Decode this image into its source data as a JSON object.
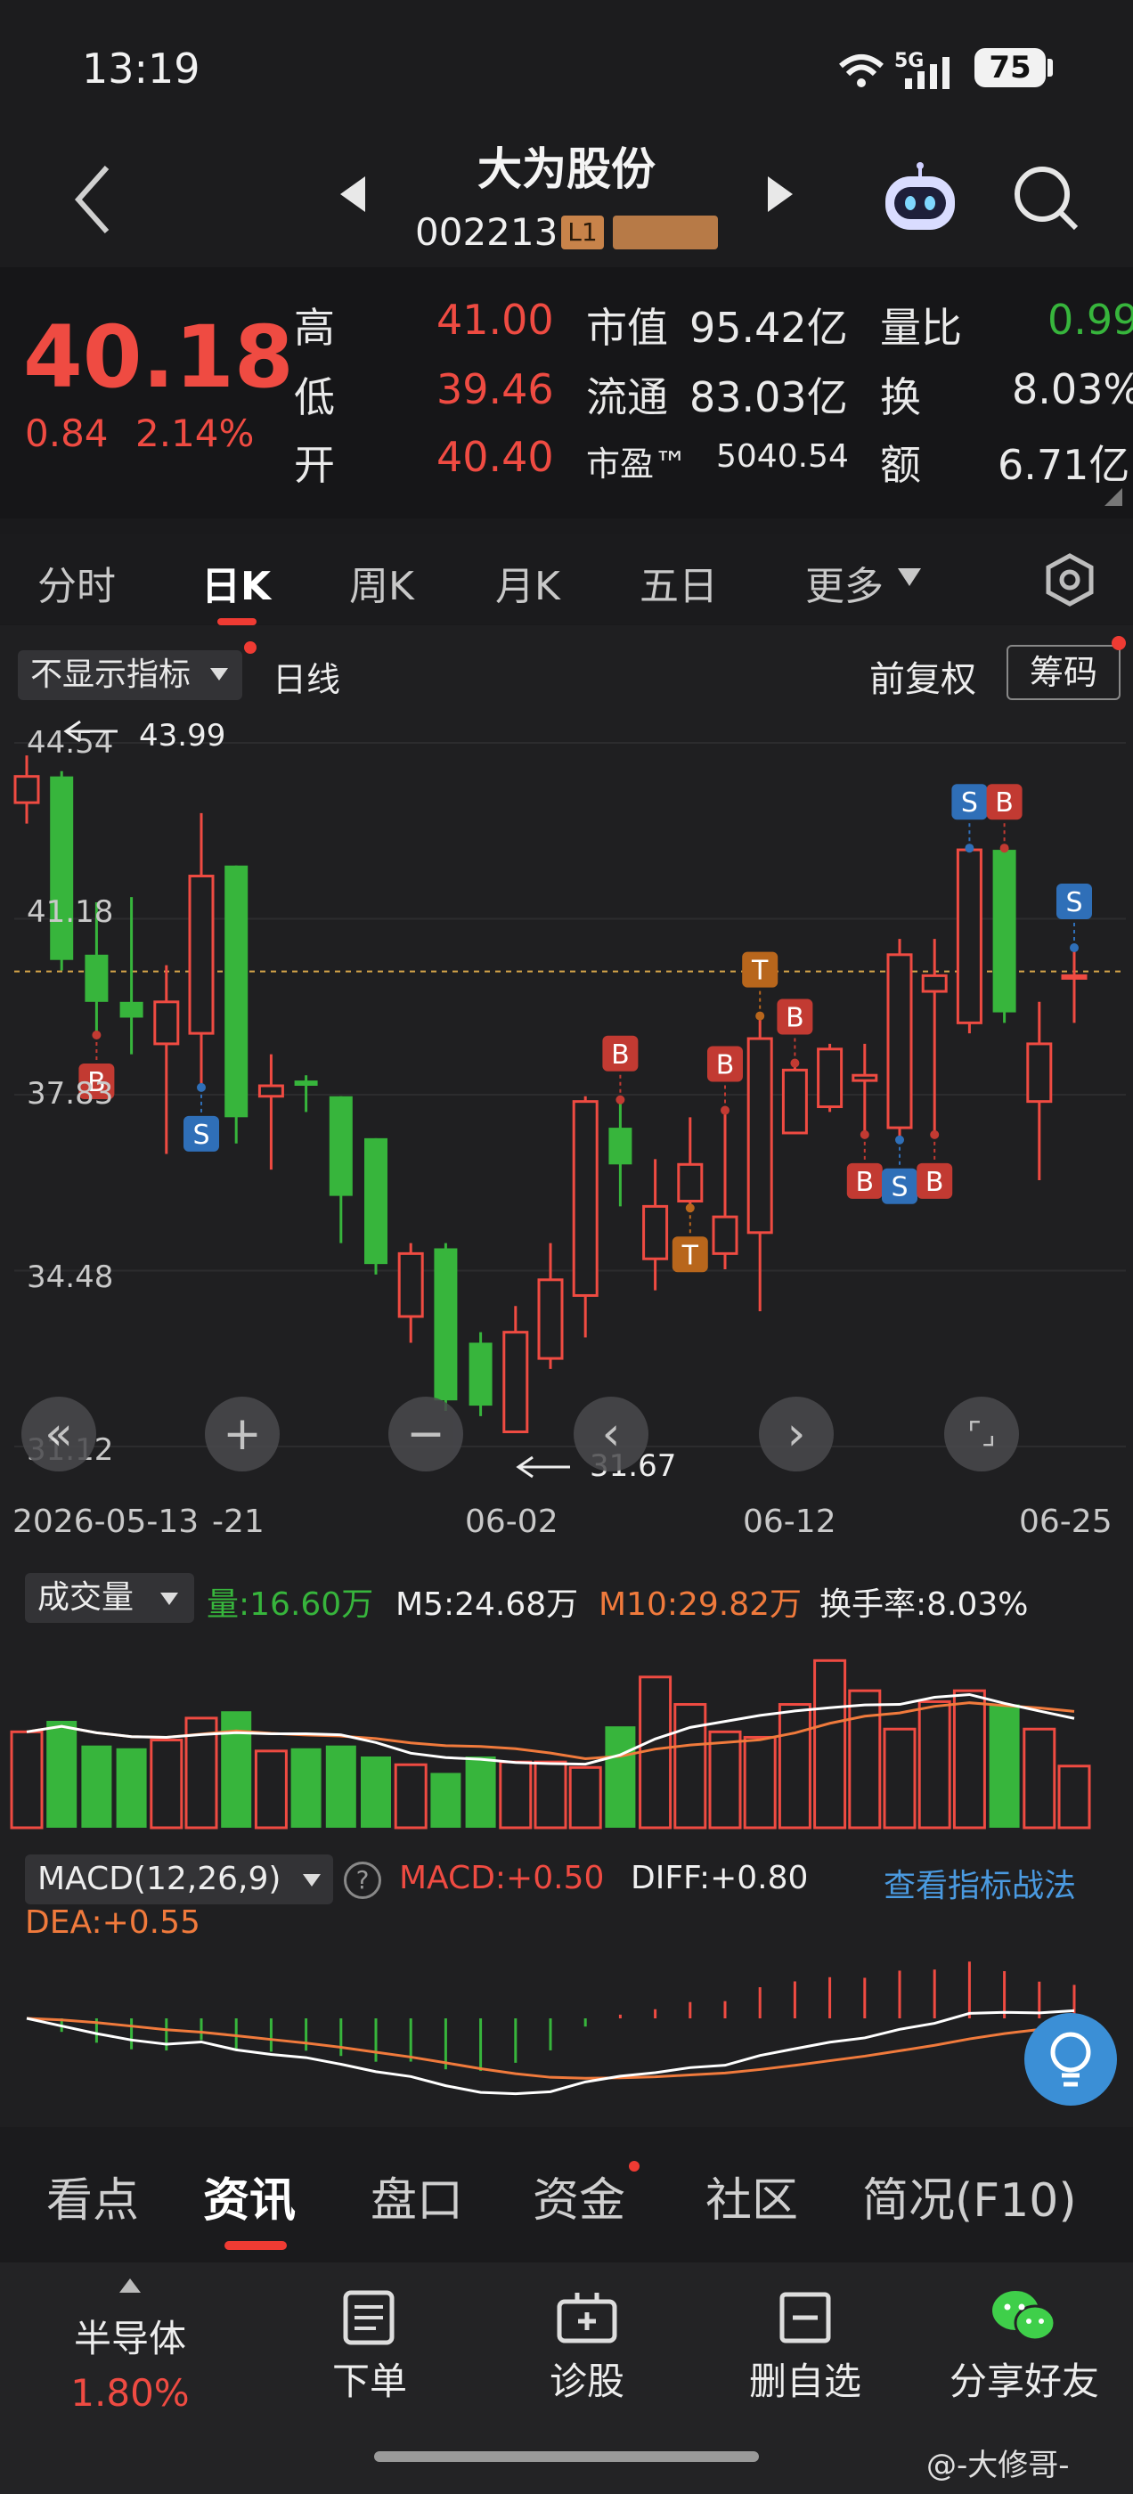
{
  "status_bar": {
    "time": "13:19",
    "network": "5G",
    "battery": "75"
  },
  "header": {
    "stock_name": "大为股份",
    "stock_code": "002213",
    "level_badge": "L1"
  },
  "quote": {
    "price": "40.18",
    "change": "0.84",
    "change_pct": "2.14%",
    "high_label": "高",
    "high": "41.00",
    "low_label": "低",
    "low": "39.46",
    "open_label": "开",
    "open": "40.40",
    "mcap_label": "市值",
    "mcap": "95.42亿",
    "float_label": "流通",
    "float": "83.03亿",
    "pe_label": "市盈™",
    "pe": "5040.54",
    "vol_ratio_label": "量比",
    "vol_ratio": "0.99",
    "turnover_label": "换",
    "turnover": "8.03%",
    "amount_label": "额",
    "amount": "6.71亿"
  },
  "tabs": [
    {
      "label": "分时"
    },
    {
      "label": "日K"
    },
    {
      "label": "周K"
    },
    {
      "label": "月K"
    },
    {
      "label": "五日"
    },
    {
      "label": "更多"
    }
  ],
  "chart_toolbar": {
    "indicator": "不显示指标",
    "period": "日线",
    "adjust": "前复权",
    "chip": "筹码"
  },
  "price_axis": [
    "44.54",
    "41.18",
    "37.83",
    "34.48",
    "31.12"
  ],
  "annotations": {
    "max": "43.99",
    "min": "31.67"
  },
  "date_axis": [
    "2026-05-13",
    "-21",
    "06-02",
    "06-12",
    "06-25"
  ],
  "controls": [
    "«",
    "+",
    "−",
    "‹",
    "›",
    "⌜⌟"
  ],
  "volume": {
    "dropdown": "成交量",
    "vol": "量:16.60万",
    "m5": "M5:24.68万",
    "m10": "M10:29.82万",
    "turnover": "换手率:8.03%"
  },
  "macd": {
    "dropdown": "MACD(12,26,9)",
    "macd": "MACD:+0.50",
    "diff": "DIFF:+0.80",
    "dea": "DEA:+0.55",
    "strategy_link": "查看指标战法"
  },
  "colors": {
    "up": "#ef4b42",
    "down": "#37b53c",
    "buy_marker": "#c23a32",
    "sell_marker": "#2f6fb8",
    "t_marker": "#b8661c"
  },
  "chart_data": {
    "type": "candlestick",
    "candles": [
      {
        "o": 43.4,
        "c": 43.9,
        "h": 44.3,
        "l": 43.0
      },
      {
        "o": 43.9,
        "c": 40.4,
        "h": 44.0,
        "l": 40.2
      },
      {
        "o": 40.5,
        "c": 39.6,
        "h": 41.5,
        "l": 38.9
      },
      {
        "o": 39.6,
        "c": 39.3,
        "h": 41.6,
        "l": 38.6
      },
      {
        "o": 38.8,
        "c": 39.6,
        "h": 40.3,
        "l": 36.7
      },
      {
        "o": 39.0,
        "c": 42.0,
        "h": 43.2,
        "l": 37.9
      },
      {
        "o": 42.2,
        "c": 37.4,
        "h": 42.2,
        "l": 36.9
      },
      {
        "o": 37.8,
        "c": 38.0,
        "h": 38.6,
        "l": 36.4
      },
      {
        "o": 38.1,
        "c": 38.0,
        "h": 38.2,
        "l": 37.5
      },
      {
        "o": 37.8,
        "c": 35.9,
        "h": 37.8,
        "l": 35.0
      },
      {
        "o": 37.0,
        "c": 34.6,
        "h": 37.0,
        "l": 34.4
      },
      {
        "o": 33.6,
        "c": 34.8,
        "h": 35.0,
        "l": 33.1
      },
      {
        "o": 34.9,
        "c": 32.0,
        "h": 35.0,
        "l": 31.8
      },
      {
        "o": 33.1,
        "c": 31.9,
        "h": 33.3,
        "l": 31.7
      },
      {
        "o": 31.4,
        "c": 33.3,
        "h": 33.8,
        "l": 31.6
      },
      {
        "o": 32.8,
        "c": 34.3,
        "h": 35.0,
        "l": 32.6
      },
      {
        "o": 34.0,
        "c": 37.7,
        "h": 37.8,
        "l": 33.2
      },
      {
        "o": 37.2,
        "c": 36.5,
        "h": 37.8,
        "l": 35.7
      },
      {
        "o": 34.7,
        "c": 35.7,
        "h": 36.6,
        "l": 34.1
      },
      {
        "o": 35.8,
        "c": 36.5,
        "h": 37.4,
        "l": 35.6
      },
      {
        "o": 34.8,
        "c": 35.5,
        "h": 37.6,
        "l": 34.5
      },
      {
        "o": 35.2,
        "c": 38.9,
        "h": 39.4,
        "l": 33.7
      },
      {
        "o": 37.1,
        "c": 38.3,
        "h": 38.5,
        "l": 37.5
      },
      {
        "o": 37.6,
        "c": 38.7,
        "h": 38.8,
        "l": 37.5
      },
      {
        "o": 38.1,
        "c": 38.2,
        "h": 38.8,
        "l": 37.0
      },
      {
        "o": 37.2,
        "c": 40.5,
        "h": 40.8,
        "l": 36.9
      },
      {
        "o": 39.8,
        "c": 40.1,
        "h": 40.8,
        "l": 37.0
      },
      {
        "o": 39.2,
        "c": 42.5,
        "h": 42.6,
        "l": 39.0
      },
      {
        "o": 42.5,
        "c": 39.4,
        "h": 42.6,
        "l": 39.2
      },
      {
        "o": 37.7,
        "c": 38.8,
        "h": 39.6,
        "l": 36.2
      },
      {
        "o": 40.1,
        "c": 40.1,
        "h": 40.7,
        "l": 39.2
      }
    ],
    "volume": [
      70,
      78,
      60,
      58,
      64,
      80,
      85,
      56,
      58,
      60,
      52,
      46,
      40,
      52,
      48,
      48,
      44,
      74,
      110,
      90,
      70,
      66,
      90,
      122,
      100,
      72,
      92,
      100,
      90,
      72,
      45
    ],
    "markers": [
      {
        "i": 2,
        "t": "B",
        "pos": "below"
      },
      {
        "i": 5,
        "t": "S",
        "pos": "below"
      },
      {
        "i": 17,
        "t": "B",
        "pos": "above"
      },
      {
        "i": 19,
        "t": "T",
        "pos": "below"
      },
      {
        "i": 20,
        "t": "B",
        "pos": "above"
      },
      {
        "i": 21,
        "t": "T",
        "pos": "above"
      },
      {
        "i": 22,
        "t": "B",
        "pos": "above"
      },
      {
        "i": 24,
        "t": "B",
        "pos": "below"
      },
      {
        "i": 25,
        "t": "S",
        "pos": "below"
      },
      {
        "i": 26,
        "t": "B",
        "pos": "below"
      },
      {
        "i": 27,
        "t": "S",
        "pos": "above"
      },
      {
        "i": 28,
        "t": "B",
        "pos": "above"
      },
      {
        "i": 30,
        "t": "S",
        "pos": "above"
      }
    ],
    "ylim": [
      31.12,
      44.54
    ]
  },
  "news_tabs": [
    {
      "label": "看点"
    },
    {
      "label": "资讯"
    },
    {
      "label": "盘口"
    },
    {
      "label": "资金"
    },
    {
      "label": "社区"
    },
    {
      "label": "简况(F10)"
    }
  ],
  "actions": {
    "sector_name": "半导体",
    "sector_pct": "1.80%",
    "order": "下单",
    "diagnose": "诊股",
    "remove_watch": "删自选",
    "share": "分享好友"
  },
  "watermark": "@-大修哥-"
}
